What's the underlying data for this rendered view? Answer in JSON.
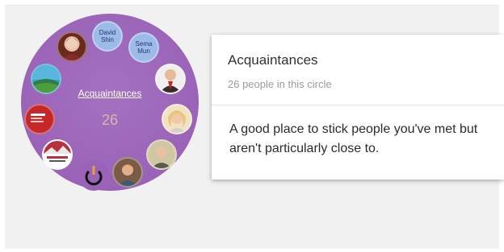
{
  "circle": {
    "name": "Acquaintances",
    "count": "26",
    "background_color": "#9a63b8",
    "members": [
      {
        "label": "",
        "kind": "photo"
      },
      {
        "label": "David Shin",
        "kind": "placeholder"
      },
      {
        "label": "Sema Mun",
        "kind": "placeholder"
      },
      {
        "label": "",
        "kind": "photo"
      },
      {
        "label": "",
        "kind": "photo"
      },
      {
        "label": "",
        "kind": "photo"
      },
      {
        "label": "",
        "kind": "photo"
      },
      {
        "label": "",
        "kind": "logo"
      },
      {
        "label": "",
        "kind": "logo"
      },
      {
        "label": "",
        "kind": "logo"
      },
      {
        "label": "",
        "kind": "photo"
      }
    ]
  },
  "card": {
    "title": "Acquaintances",
    "subtitle": "26 people in this circle",
    "description": "A good place to stick people you've met but aren't particularly close to."
  }
}
